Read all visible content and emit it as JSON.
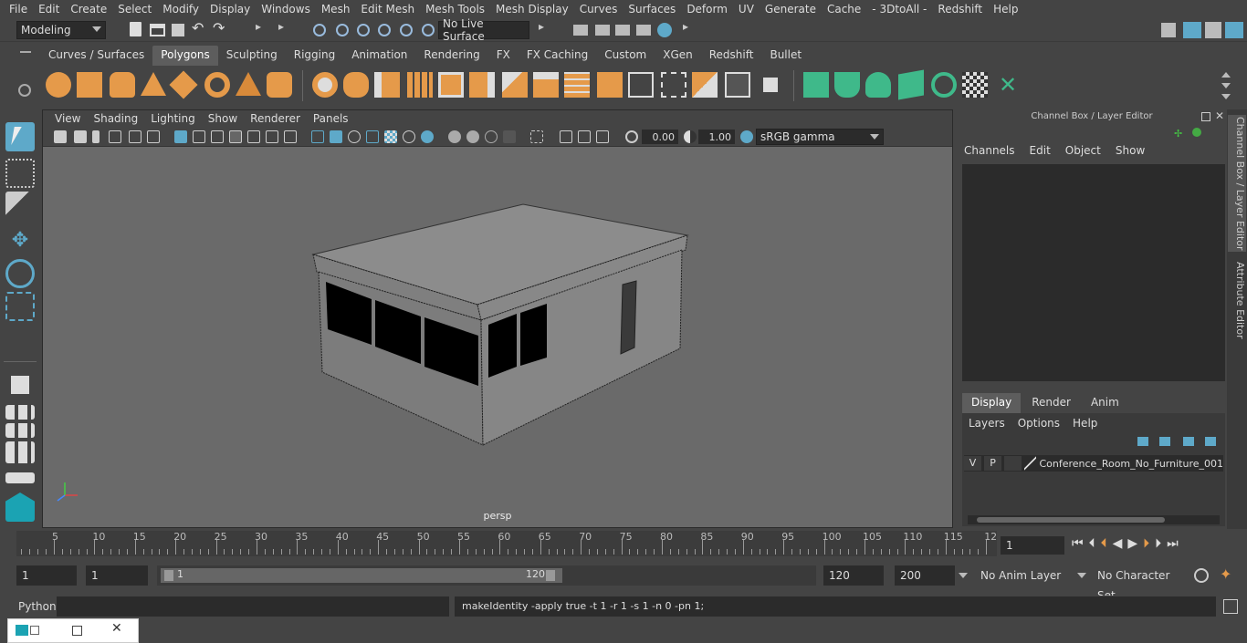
{
  "menubar": {
    "items": [
      "File",
      "Edit",
      "Create",
      "Select",
      "Modify",
      "Display",
      "Windows",
      "Mesh",
      "Edit Mesh",
      "Mesh Tools",
      "Mesh Display",
      "Curves",
      "Surfaces",
      "Deform",
      "UV",
      "Generate",
      "Cache",
      "- 3DtoAll -",
      "Redshift",
      "Help"
    ]
  },
  "statusline": {
    "workspace": "Modeling",
    "live_surface": "No Live Surface"
  },
  "shelf": {
    "tabs": [
      "Curves / Surfaces",
      "Polygons",
      "Sculpting",
      "Rigging",
      "Animation",
      "Rendering",
      "FX",
      "FX Caching",
      "Custom",
      "XGen",
      "Redshift",
      "Bullet"
    ],
    "active_tab": "Polygons"
  },
  "viewport": {
    "menus": [
      "View",
      "Shading",
      "Lighting",
      "Show",
      "Renderer",
      "Panels"
    ],
    "exposure": "0.00",
    "gamma": "1.00",
    "color_space": "sRGB gamma",
    "camera_label": "persp"
  },
  "channel_box": {
    "title": "Channel Box / Layer Editor",
    "menus": [
      "Channels",
      "Edit",
      "Object",
      "Show"
    ],
    "tabs": [
      "Display",
      "Render",
      "Anim"
    ],
    "active_tab": "Display",
    "layer_menus": [
      "Layers",
      "Options",
      "Help"
    ],
    "layer": {
      "v": "V",
      "p": "P",
      "name": "Conference_Room_No_Furniture_001"
    }
  },
  "side_tabs": [
    "Channel Box / Layer Editor",
    "Attribute Editor"
  ],
  "timeline": {
    "ticks": [
      "5",
      "10",
      "15",
      "20",
      "25",
      "30",
      "35",
      "40",
      "45",
      "50",
      "55",
      "60",
      "65",
      "70",
      "75",
      "80",
      "85",
      "90",
      "95",
      "100",
      "105",
      "110",
      "115",
      "12"
    ],
    "start_label": "1",
    "current_frame": "1"
  },
  "range": {
    "start": "1",
    "playback_start": "1",
    "slider_start": "1",
    "slider_end": "120",
    "playback_end": "120",
    "end": "200",
    "anim_layer": "No Anim Layer",
    "character_set": "No Character Set"
  },
  "command": {
    "language": "Python",
    "output": "makeIdentity -apply true -t 1 -r 1 -s 1 -n 0 -pn 1;"
  },
  "colors": {
    "accent": "#5ea9c9",
    "shelf_orange": "#e59a4a",
    "shelf_green": "#3fb98a"
  }
}
